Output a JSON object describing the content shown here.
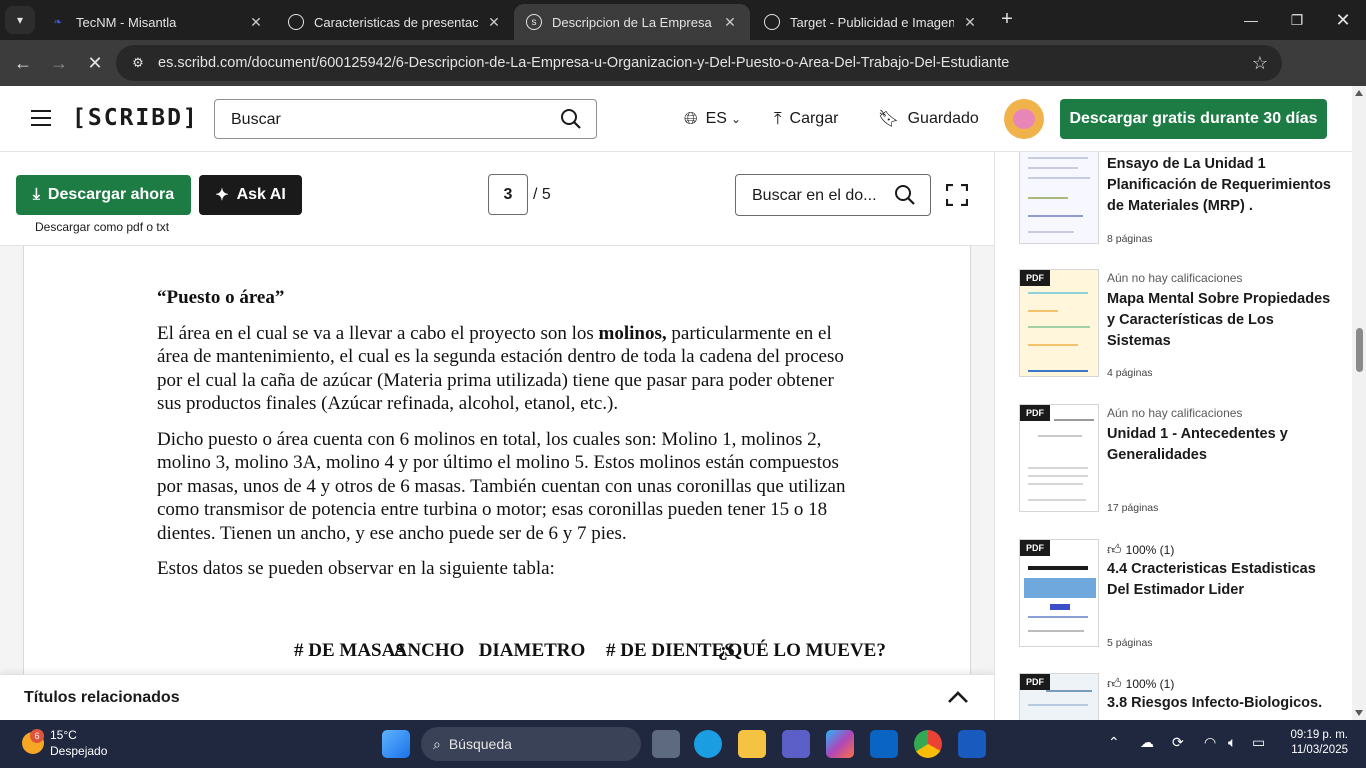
{
  "browser": {
    "tabs": [
      {
        "title": "TecNM - Misantla",
        "favicon": "tecnm-icon"
      },
      {
        "title": "Caracteristicas de presentacion",
        "favicon": "globe-icon"
      },
      {
        "title": "Descripcion de La Empresa U O",
        "favicon": "scribd-icon"
      },
      {
        "title": "Target - Publicidad e Imagen",
        "favicon": "globe-icon"
      }
    ],
    "url": "es.scribd.com/document/600125942/6-Descripcion-de-La-Empresa-u-Organizacion-y-Del-Puesto-o-Area-Del-Trabajo-Del-Estudiante"
  },
  "header": {
    "logo": "[SCRIBD]",
    "search_placeholder": "Buscar",
    "language": "ES",
    "upload": "Cargar",
    "saved": "Guardado",
    "cta": "Descargar gratis durante 30 días"
  },
  "toolbar": {
    "download_now": "Descargar ahora",
    "ask_ai": "Ask AI",
    "download_note": "Descargar como pdf o txt",
    "current_page": "3",
    "total_pages": "/ 5",
    "doc_search_placeholder": "Buscar en el do..."
  },
  "document": {
    "heading": "“Puesto o área”",
    "p1_pre": "El área en el cual se va a llevar a cabo el proyecto son los ",
    "p1_bold": "molinos,",
    "p1_post": " particularmente en el área de mantenimiento, el cual es la segunda estación dentro de toda la cadena del proceso por el cual la caña de azúcar (Materia prima utilizada) tiene que pasar para poder obtener sus productos finales (Azúcar refinada, alcohol, etanol, etc.).",
    "p2": "Dicho puesto o área cuenta con 6 molinos en total, los cuales son: Molino 1, molinos 2, molino 3, molino 3A, molino 4 y por último el molino 5. Estos molinos están compuestos por masas, unos de 4 y otros de 6 masas. También cuentan con unas coronillas que utilizan como transmisor de potencia entre turbina o motor; esas coronillas pueden tener 15 o 18 dientes. Tienen un ancho, y ese ancho puede ser de 6 y 7 pies.",
    "p3": "Estos datos se pueden observar en la siguiente tabla:",
    "table_headers": [
      "# DE MASAS",
      "ANCHO",
      "DIAMETRO",
      "# DE DIENTES",
      "¿QUÉ LO MUEVE?"
    ]
  },
  "related": {
    "title": "Títulos relacionados"
  },
  "sidebar": {
    "cards": [
      {
        "meta": "",
        "title": "Ensayo de La Unidad 1 Planificación de Requerimientos de Materiales (MRP) .",
        "pages": "8 páginas"
      },
      {
        "meta": "Aún no hay calificaciones",
        "title": "Mapa Mental Sobre Propiedades y Características de Los Sistemas",
        "pages": "4 páginas",
        "badge": "PDF"
      },
      {
        "meta": "Aún no hay calificaciones",
        "title": "Unidad 1 - Antecedentes y Generalidades",
        "pages": "17 páginas",
        "badge": "PDF"
      },
      {
        "meta": "100% (1)",
        "title": "4.4 Cracteristicas Estadisticas Del Estimador Lider",
        "pages": "5 páginas",
        "badge": "PDF"
      },
      {
        "meta": "100% (1)",
        "title": "3.8 Riesgos Infecto-Biologicos.",
        "pages": "",
        "badge": "PDF"
      }
    ]
  },
  "taskbar": {
    "weather_temp": "15°C",
    "weather_desc": "Despejado",
    "weather_badge": "6",
    "search": "Búsqueda",
    "time": "09:19 p. m.",
    "date": "11/03/2025"
  }
}
